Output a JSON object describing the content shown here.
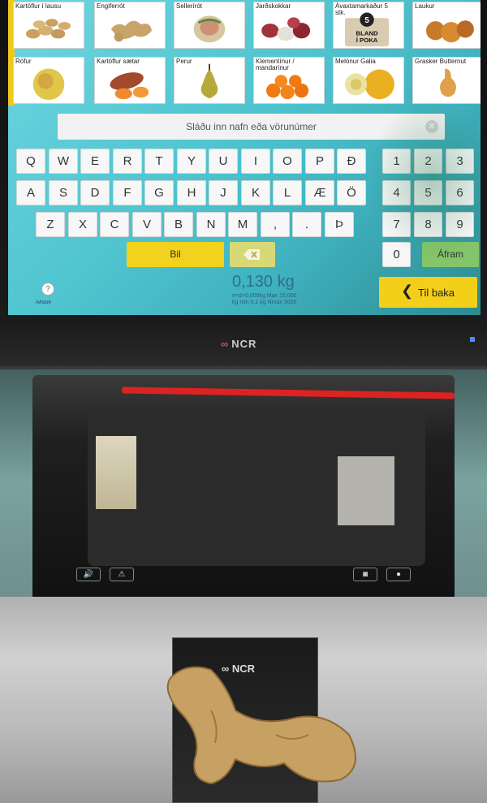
{
  "products": [
    {
      "label": "Kartöflur í lausu",
      "icon": "potato"
    },
    {
      "label": "Engiferrót",
      "icon": "ginger"
    },
    {
      "label": "Sellerírót",
      "icon": "celeriac"
    },
    {
      "label": "Jarðskokkar",
      "icon": "jerusalem-artichoke"
    },
    {
      "label": "Ávaxtamarkaður 5\nstk.",
      "icon": "fruit-bag",
      "badge_number": "5",
      "badge_text": "BLAND\nÍ POKA"
    },
    {
      "label": "Laukur",
      "icon": "onion"
    },
    {
      "label": "Rófur",
      "icon": "turnip"
    },
    {
      "label": "Kartöflur sætar",
      "icon": "sweet-potato"
    },
    {
      "label": "Perur",
      "icon": "pear"
    },
    {
      "label": "Klementínur /\nmandarínur",
      "icon": "clementine"
    },
    {
      "label": "Melónur Galia",
      "icon": "melon"
    },
    {
      "label": "Grasker Butternut",
      "icon": "butternut-squash"
    }
  ],
  "search": {
    "placeholder": "Sláðu inn nafn eða vörunúmer"
  },
  "keyboard": {
    "row1": [
      "Q",
      "W",
      "E",
      "R",
      "T",
      "Y",
      "U",
      "I",
      "O",
      "P",
      "Ð"
    ],
    "row2": [
      "A",
      "S",
      "D",
      "F",
      "G",
      "H",
      "J",
      "K",
      "L",
      "Æ",
      "Ö"
    ],
    "row3": [
      "Z",
      "X",
      "C",
      "V",
      "B",
      "N",
      "M",
      ",",
      ".",
      "Þ"
    ],
    "space_label": "Bil",
    "continue_label": "Áfram"
  },
  "numpad": [
    "1",
    "2",
    "3",
    "4",
    "5",
    "6",
    "7",
    "8",
    "9",
    "0"
  ],
  "weight": {
    "value": "0,130 kg",
    "info_line1": "e=d=0,005kg Max 15,000",
    "info_line2": "kg min 0,1 kg Nmax 3000"
  },
  "back_button": {
    "label": "Til baka"
  },
  "help": {
    "label": "Aðstoð"
  },
  "brand": "NCR",
  "colors": {
    "screen": "#4fc4cf",
    "accent_yellow": "#f4cf1a",
    "accent_green": "#84c46a",
    "brand_red": "#d05050"
  }
}
